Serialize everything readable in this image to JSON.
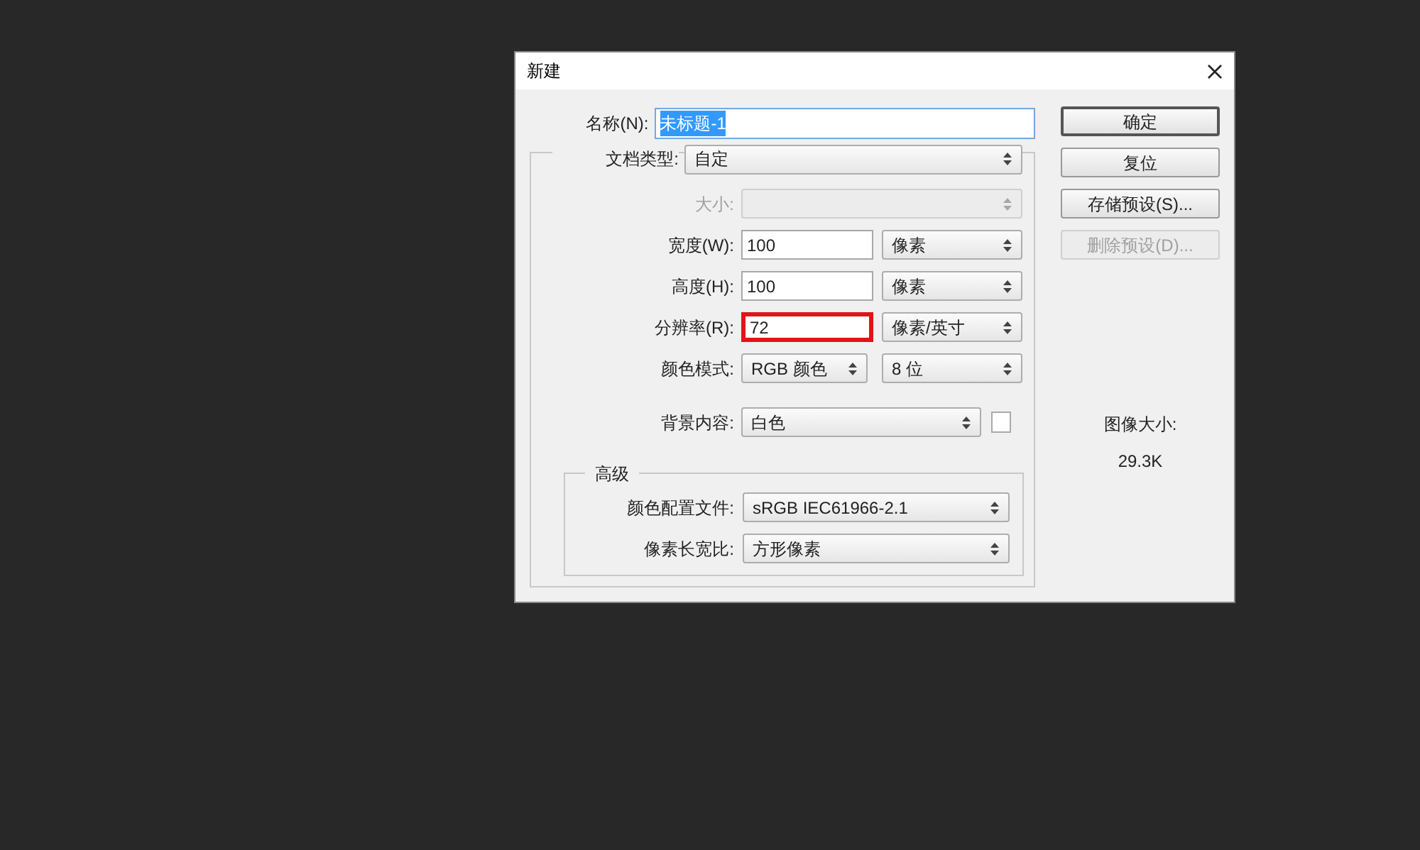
{
  "window": {
    "title": "新建"
  },
  "name_field": {
    "label": "名称(N):",
    "value": "未标题-1",
    "selected": true
  },
  "document_type": {
    "label": "文档类型:",
    "value": "自定"
  },
  "size": {
    "label": "大小:",
    "disabled": true
  },
  "fields": [
    {
      "label": "宽度(W):",
      "value": "100",
      "unit": "像素",
      "highlighted": false
    },
    {
      "label": "高度(H):",
      "value": "100",
      "unit": "像素",
      "highlighted": false
    },
    {
      "label": "分辨率(R):",
      "value": "72",
      "unit": "像素/英寸",
      "highlighted": true
    }
  ],
  "color_mode": {
    "label": "颜色模式:",
    "value": "RGB 颜色",
    "bits": "8 位"
  },
  "background": {
    "label": "背景内容:",
    "value": "白色"
  },
  "advanced": {
    "legend": "高级",
    "rows": [
      {
        "label": "颜色配置文件:",
        "value": "sRGB IEC61966-2.1"
      },
      {
        "label": "像素长宽比:",
        "value": "方形像素"
      }
    ]
  },
  "buttons": [
    {
      "label": "确定",
      "default": true,
      "disabled": false
    },
    {
      "label": "复位",
      "default": false,
      "disabled": false
    },
    {
      "label": "存储预设(S)...",
      "default": false,
      "disabled": false
    },
    {
      "label": "删除预设(D)...",
      "default": false,
      "disabled": true
    }
  ],
  "image_size": {
    "label": "图像大小:",
    "value": "29.3K"
  }
}
